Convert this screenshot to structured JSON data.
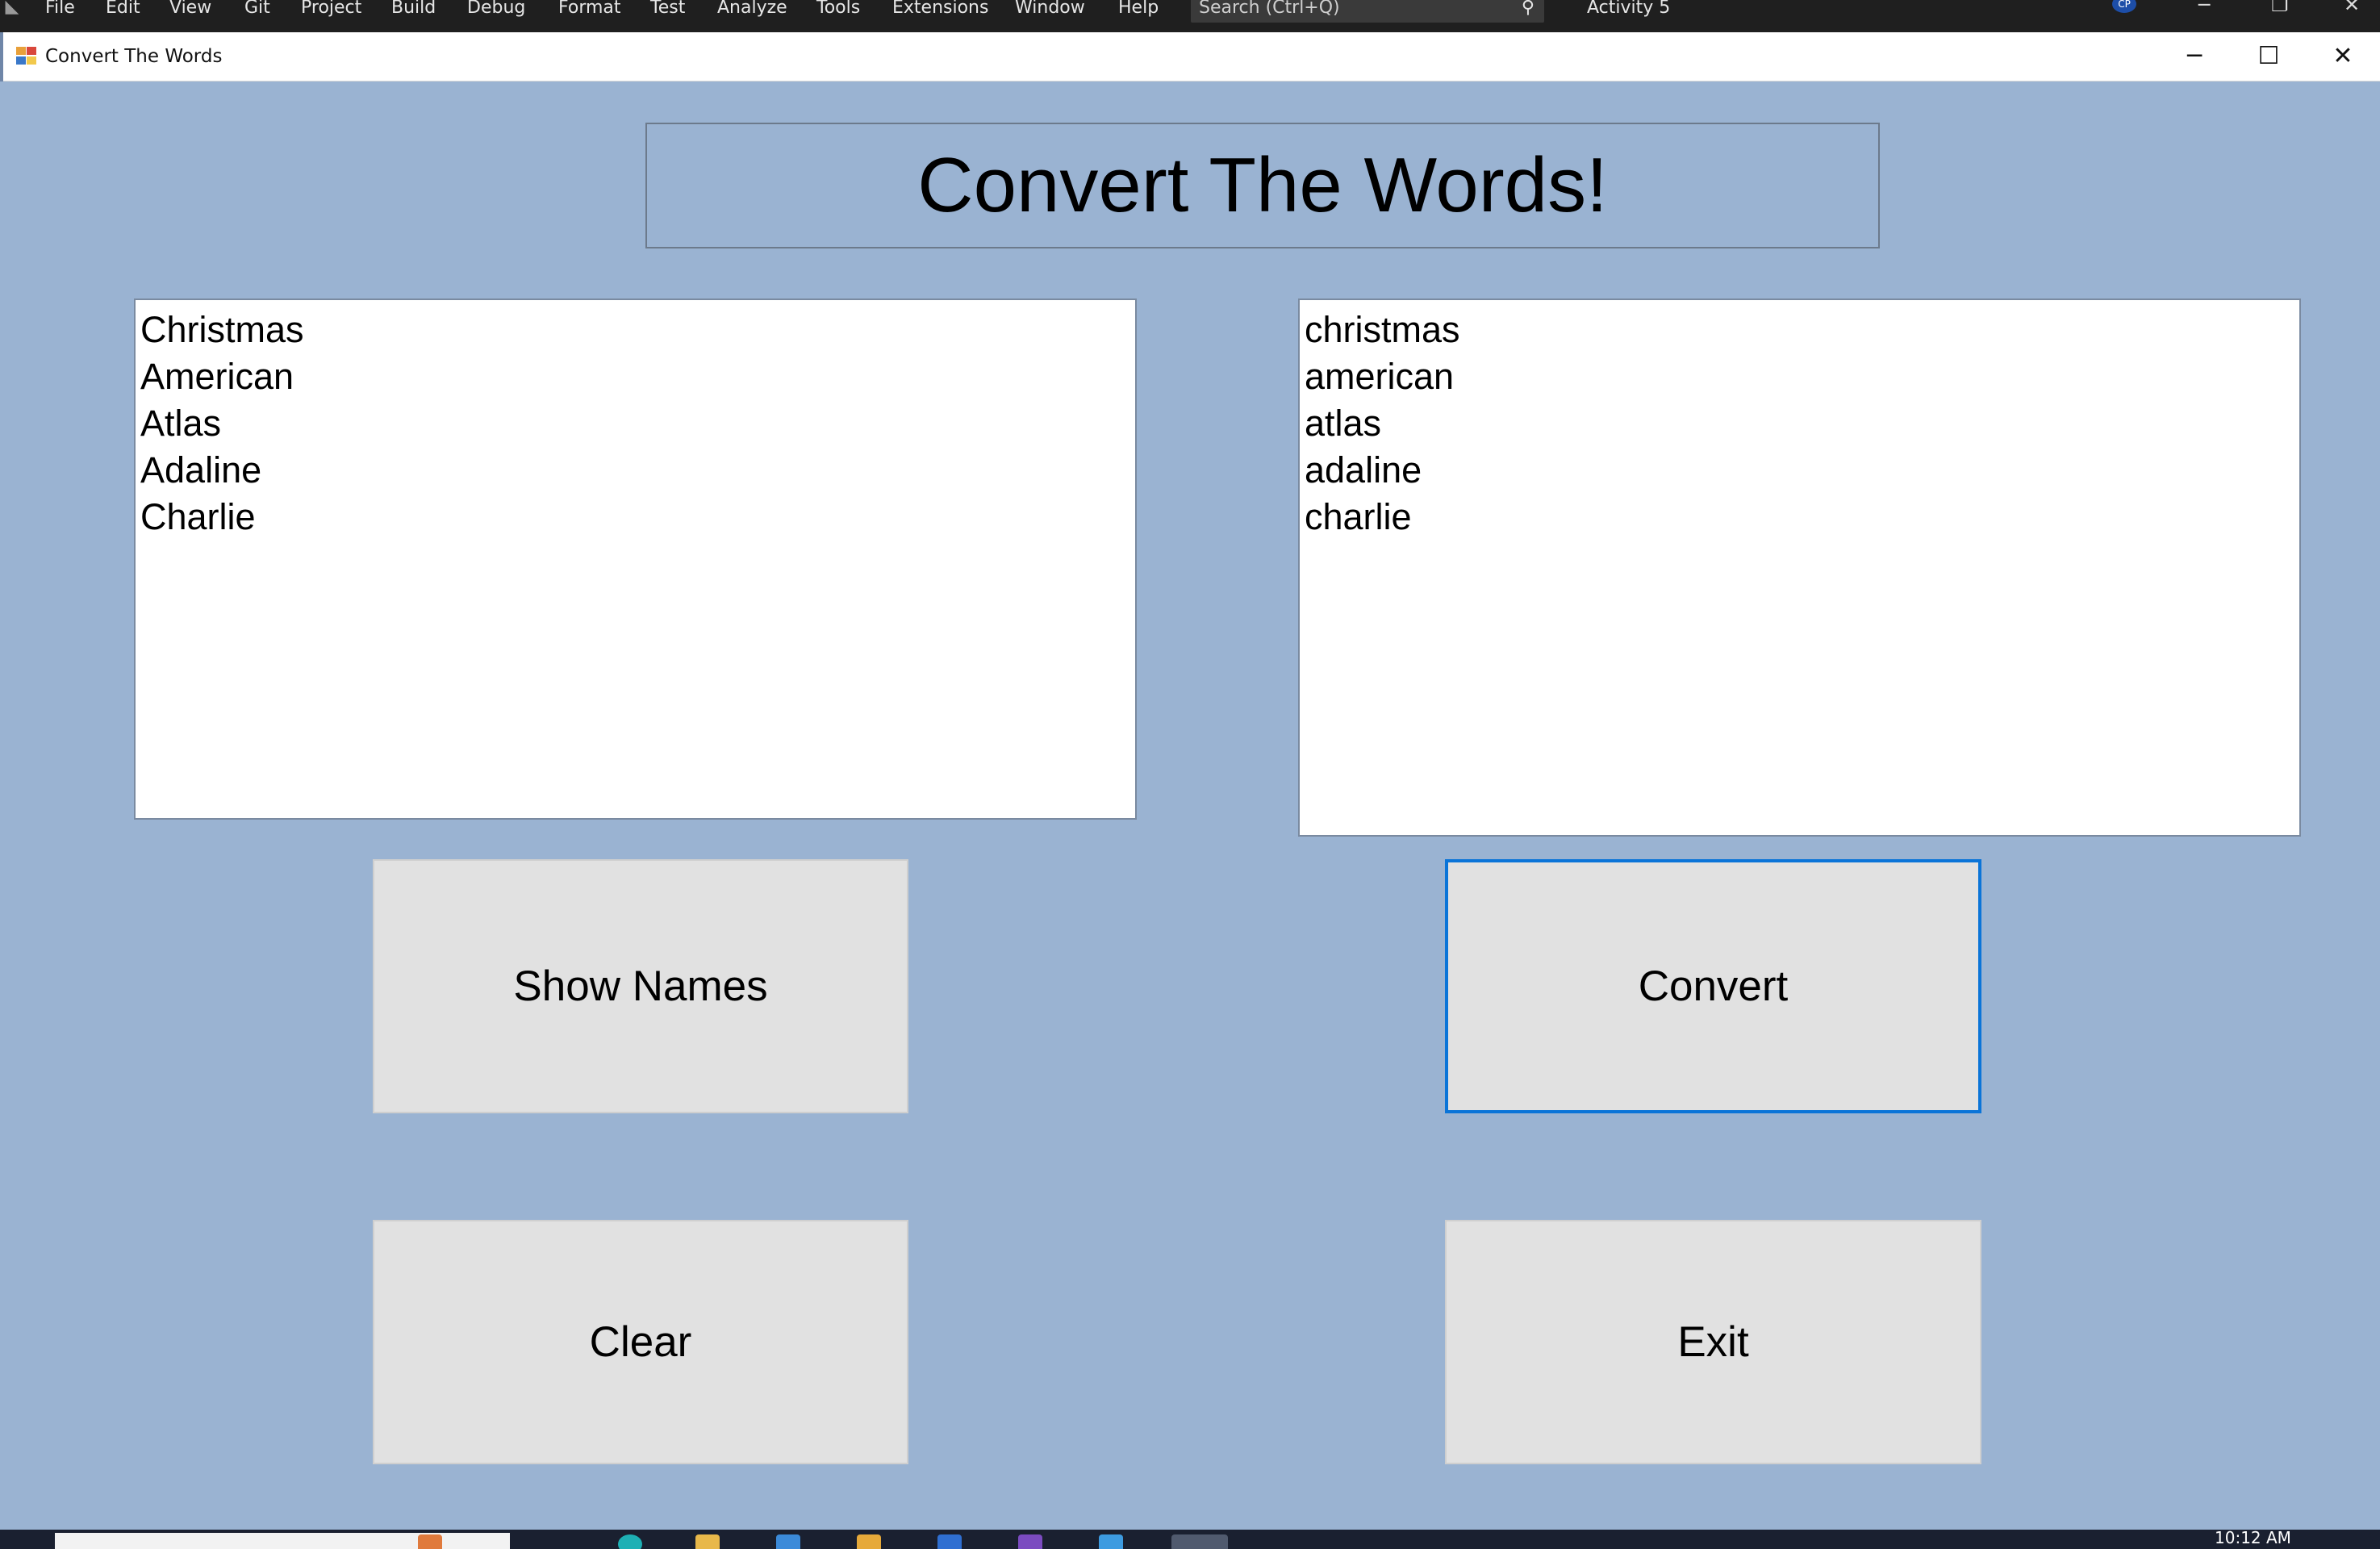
{
  "ide": {
    "menu": [
      "File",
      "Edit",
      "View",
      "Git",
      "Project",
      "Build",
      "Debug",
      "Format",
      "Test",
      "Analyze",
      "Tools",
      "Extensions",
      "Window",
      "Help"
    ],
    "search_placeholder": "Search (Ctrl+Q)",
    "solution_name": "Activity 5",
    "user_initials": "CP"
  },
  "window": {
    "title": "Convert The Words"
  },
  "form": {
    "heading": "Convert The Words!",
    "names_list": [
      "Christmas",
      "American",
      "Atlas",
      "Adaline",
      "Charlie"
    ],
    "converted_list": [
      "christmas",
      "american",
      "atlas",
      "adaline",
      "charlie"
    ],
    "buttons": {
      "show_names": "Show Names",
      "convert": "Convert",
      "clear": "Clear",
      "exit": "Exit"
    }
  },
  "taskbar": {
    "clock": "10:12 AM"
  },
  "colors": {
    "form_background": "#9ab3d2",
    "focus_border": "#0a74d8",
    "button_face": "#e1e1e1"
  }
}
